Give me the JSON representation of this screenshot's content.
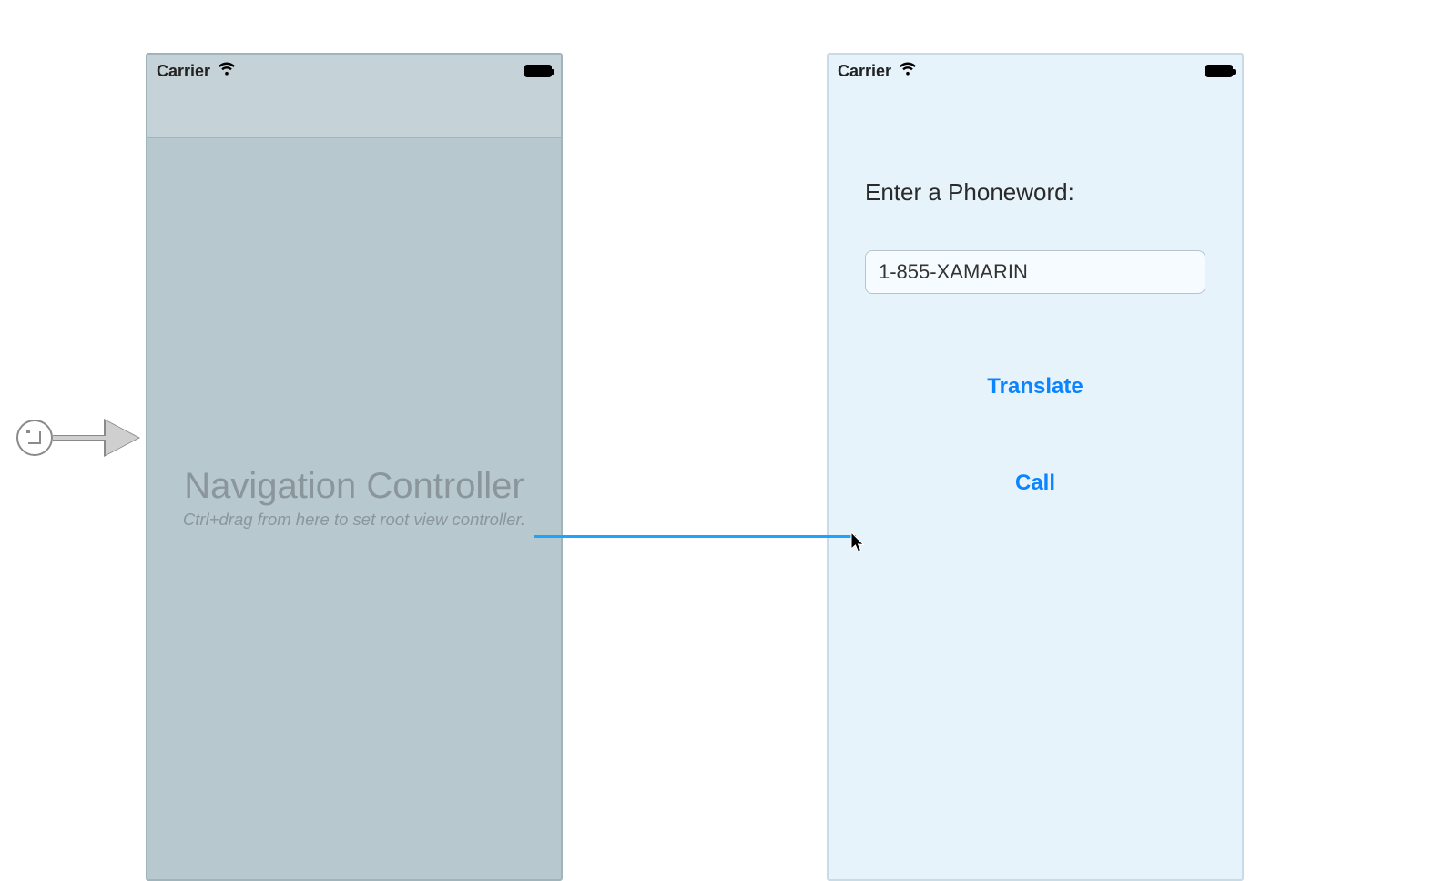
{
  "statusbar": {
    "carrier_label": "Carrier"
  },
  "nav_controller": {
    "title": "Navigation Controller",
    "hint": "Ctrl+drag from here to set root view controller."
  },
  "phoneword": {
    "prompt": "Enter a Phoneword:",
    "input_value": "1-855-XAMARIN",
    "translate_label": "Translate",
    "call_label": "Call"
  }
}
